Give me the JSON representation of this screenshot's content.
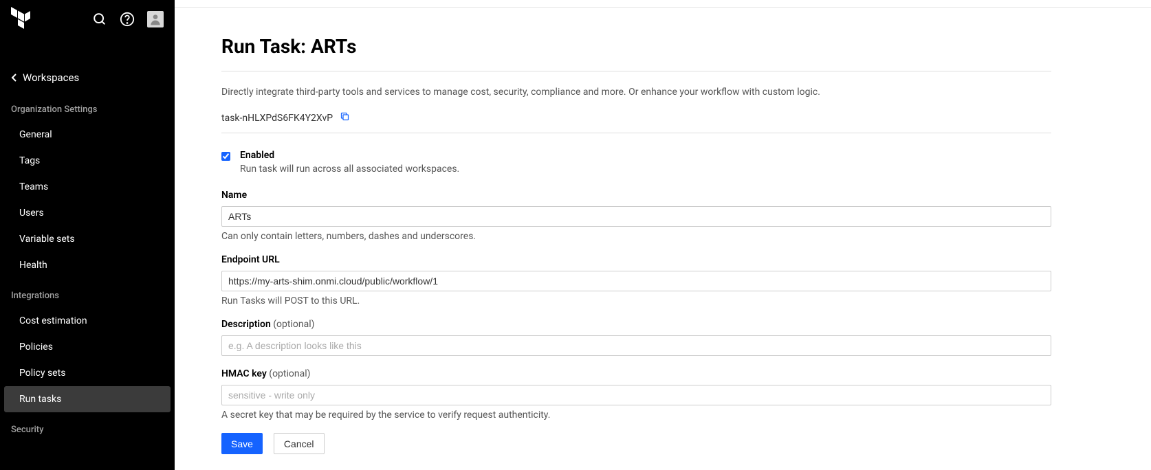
{
  "sidebar": {
    "back_label": "Workspaces",
    "section1": "Organization Settings",
    "items1": [
      "General",
      "Tags",
      "Teams",
      "Users",
      "Variable sets",
      "Health"
    ],
    "section2": "Integrations",
    "items2": [
      "Cost estimation",
      "Policies",
      "Policy sets",
      "Run tasks"
    ],
    "section3": "Security"
  },
  "page": {
    "title": "Run Task: ARTs",
    "intro": "Directly integrate third-party tools and services to manage cost, security, compliance and more. Or enhance your workflow with custom logic.",
    "task_id": "task-nHLXPdS6FK4Y2XvP"
  },
  "form": {
    "enabled_label": "Enabled",
    "enabled_hint": "Run task will run across all associated workspaces.",
    "name_label": "Name",
    "name_value": "ARTs",
    "name_hint": "Can only contain letters, numbers, dashes and underscores.",
    "url_label": "Endpoint URL",
    "url_value": "https://my-arts-shim.onmi.cloud/public/workflow/1",
    "url_hint": "Run Tasks will POST to this URL.",
    "desc_label": "Description",
    "desc_opt": " (optional)",
    "desc_placeholder": "e.g. A description looks like this",
    "hmac_label": "HMAC key",
    "hmac_opt": " (optional)",
    "hmac_placeholder": "sensitive - write only",
    "hmac_hint": "A secret key that may be required by the service to verify request authenticity.",
    "save": "Save",
    "cancel": "Cancel"
  }
}
